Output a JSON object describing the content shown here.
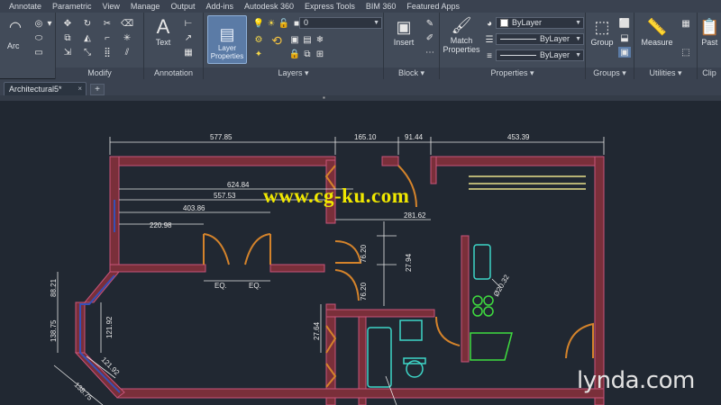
{
  "menu": {
    "tabs": [
      "Annotate",
      "Parametric",
      "View",
      "Manage",
      "Output",
      "Add-ins",
      "Autodesk 360",
      "Express Tools",
      "BIM 360",
      "Featured Apps"
    ]
  },
  "ribbon": {
    "draw": {
      "arc_label": "Arc"
    },
    "modify": {
      "title": "Modify"
    },
    "annotation": {
      "title": "Annotation",
      "text_label": "Text"
    },
    "layers": {
      "title": "Layers",
      "layer_properties_label": "Layer Properties",
      "current_layer": "0"
    },
    "block": {
      "title": "Block",
      "insert_label": "Insert"
    },
    "properties": {
      "title": "Properties",
      "match_label": "Match Properties",
      "color_value": "ByLayer",
      "linetype_value": "ByLayer",
      "lineweight_value": "ByLayer"
    },
    "groups": {
      "title": "Groups",
      "group_label": "Group"
    },
    "utilities": {
      "title": "Utilities",
      "measure_label": "Measure"
    },
    "clipboard": {
      "title": "Clip",
      "paste_label": "Past"
    }
  },
  "document": {
    "active_tab": "Architectural5*",
    "new_tab": "+",
    "close_glyph": "×"
  },
  "drawing": {
    "dims": {
      "d577": "577.85",
      "d165": "165.10",
      "d91": "91.44",
      "d453": "453.39",
      "d624": "624.84",
      "d557": "557.53",
      "d403": "403.86",
      "d220": "220.98",
      "d281": "281.62",
      "eq1": "EQ.",
      "eq2": "EQ.",
      "d76a": "76.20",
      "d76b": "76.20",
      "d27": "27.94",
      "d27b": "27.64",
      "d88": "88.21",
      "d138a": "138.75",
      "d138b": "138.75",
      "d121a": "121.92",
      "d121b": "121.92",
      "d20": "Ø20.32"
    },
    "colors": {
      "wall": "#7a2f3a",
      "wall_edge": "#c8547a",
      "door": "#d4832b",
      "fixture": "#3dd6c8",
      "window": "#e7e08a",
      "dimension": "#e6e6e6",
      "green": "#3fdc3f"
    }
  },
  "overlay": {
    "watermark": "www.cg-ku.com",
    "brand": "lynda",
    "brand_suffix": ".com"
  }
}
